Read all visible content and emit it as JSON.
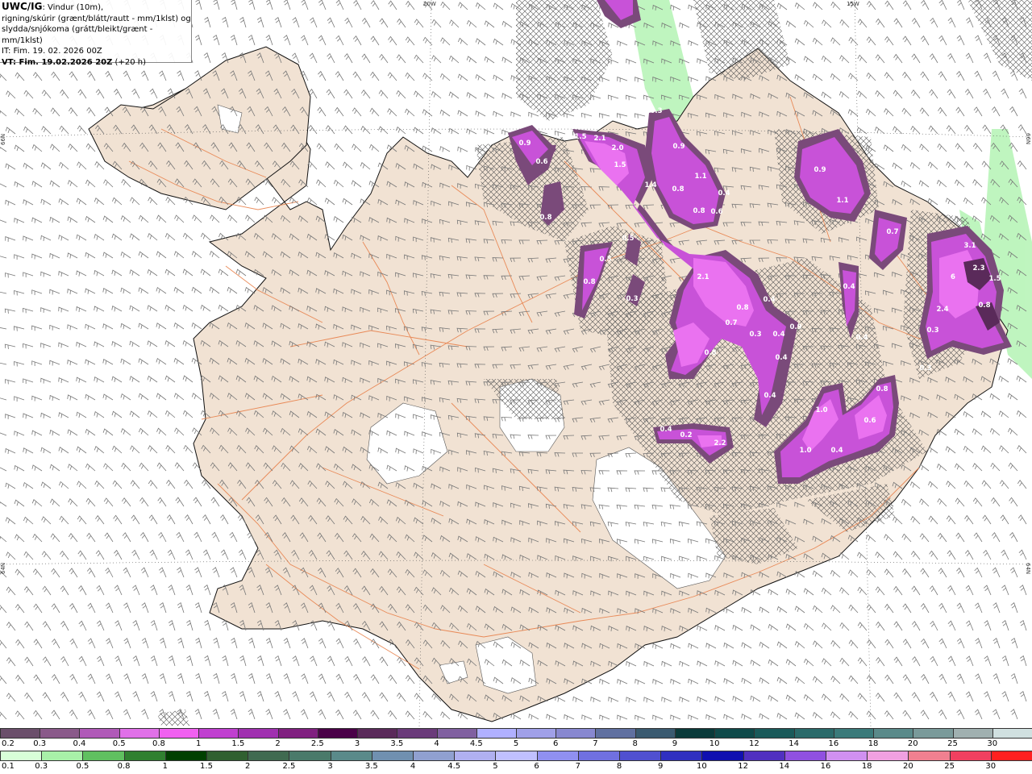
{
  "header": {
    "product": "UWC/IG",
    "line1": ": Vindur (10m),",
    "line2": "rigning/skúrir (grænt/blátt/rautt - mm/1klst) og",
    "line3": "slydda/snjókoma (grátt/bleikt/grænt - mm/1klst)",
    "it": "IT: Fim. 19. 02. 2026 00Z",
    "vt_bold": "VT: Fim. 19.02.2026 20Z",
    "vt_rest": " (+20 h)"
  },
  "colors": {
    "land": "#f1e2d3",
    "roads": "#e8804a",
    "glacier": "#ffffff",
    "snow_cell": "#c040d0",
    "snow_core": "#7a2a7a",
    "rain_light": "#a8f0a8",
    "hatch": "#555555",
    "wind_barb": "#666666"
  },
  "graticule": {
    "lon_top": [
      "20W",
      "15W"
    ],
    "lat_right": [
      "66N",
      "64N"
    ],
    "lat_left": [
      "66N",
      "64N"
    ]
  },
  "precip_labels": [
    "0.3",
    "0.9",
    "1.5",
    "2.1",
    "2.0",
    "0.9",
    "0.6",
    "1.5",
    "1.4",
    "1.1",
    "0.8",
    "0.4",
    "0.8",
    "0.6",
    "0.8",
    "0.5",
    "0.5",
    "0.8",
    "0.3",
    "0.9",
    "1.1",
    "0.7",
    "2.1",
    "0.8",
    "0.4",
    "0.7",
    "0.3",
    "0.4",
    "0.9",
    "0.4",
    "0.4",
    "0.8",
    "0.4",
    "0.4",
    "0.3",
    "1.0",
    "1.0",
    "0.6",
    "0.4",
    "0.4",
    "0.2",
    "2.2",
    "3.1",
    "2.3",
    "6",
    "1.5",
    "2.4",
    "0.8",
    "0.3",
    "0.4",
    "0.8"
  ],
  "legend_snow": {
    "values": [
      "0.2",
      "0.3",
      "0.4",
      "0.5",
      "0.8",
      "1",
      "1.5",
      "2",
      "2.5",
      "3",
      "3.5",
      "4",
      "4.5",
      "5",
      "6",
      "7",
      "8",
      "9",
      "10",
      "12",
      "14",
      "16",
      "18",
      "20",
      "25",
      "30"
    ],
    "colors": [
      "#6b4f6b",
      "#8a5a8a",
      "#b05ab8",
      "#e070e8",
      "#f060f0",
      "#c040d0",
      "#a030b0",
      "#802080",
      "#4a0048",
      "#5a2a5a",
      "#6a3a7a",
      "#8060a0",
      "#b0b0ff",
      "#a0a0e8",
      "#8888d0",
      "#6070a0",
      "#3a5a70",
      "#0a3a3a",
      "#0f4a4a",
      "#1a5a5a",
      "#2a6a6a",
      "#3a7a7a",
      "#5a8a8a",
      "#7a9a9a",
      "#a0b0b0",
      "#d0e0e0"
    ]
  },
  "legend_rain": {
    "values": [
      "0.1",
      "0.3",
      "0.5",
      "0.8",
      "1",
      "1.5",
      "2",
      "2.5",
      "3",
      "3.5",
      "4",
      "4.5",
      "5",
      "6",
      "7",
      "8",
      "9",
      "10",
      "12",
      "14",
      "16",
      "18",
      "20",
      "25",
      "30"
    ],
    "colors": [
      "#d8ffd8",
      "#a8f0a8",
      "#60c060",
      "#308030",
      "#004000",
      "#306030",
      "#406a50",
      "#4a7a6a",
      "#5a8a8a",
      "#7090b0",
      "#90a0d0",
      "#b0b0f0",
      "#c0c0ff",
      "#9090f0",
      "#7070e0",
      "#5050d0",
      "#3030c0",
      "#1010b0",
      "#5030c0",
      "#9050e0",
      "#d090f0",
      "#f0a0e0",
      "#f08090",
      "#f04060",
      "#ff2020"
    ]
  }
}
